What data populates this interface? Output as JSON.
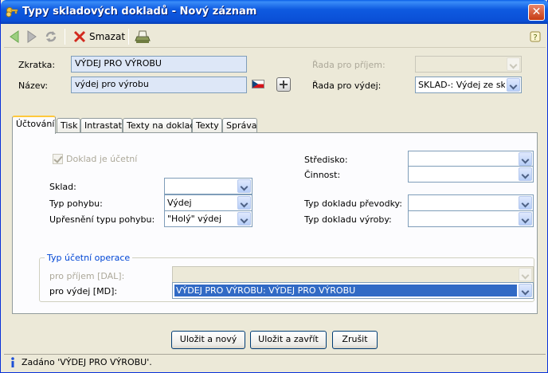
{
  "window": {
    "title": "Typy skladových dokladů - Nový záznam",
    "close_label": "✕"
  },
  "toolbar": {
    "delete_label": "Smazat"
  },
  "header": {
    "code_label": "Zkratka:",
    "code_value": "VÝDEJ PRO VÝROBU",
    "name_label": "Název:",
    "name_value": "výdej pro výrobu",
    "series_in_label": "Řada pro příjem:",
    "series_in_value": "",
    "series_out_label": "Řada pro výdej:",
    "series_out_value": "SKLAD-: Výdej ze sk..."
  },
  "tabs": [
    {
      "label": "Účtování"
    },
    {
      "label": "Tisk"
    },
    {
      "label": "Intrastat"
    },
    {
      "label": "Texty na doklad"
    },
    {
      "label": "Texty"
    },
    {
      "label": "Správa"
    }
  ],
  "accounting": {
    "is_accounting_label": "Doklad je účetní",
    "warehouse_label": "Sklad:",
    "warehouse_value": "",
    "movement_type_label": "Typ pohybu:",
    "movement_type_value": "Výdej",
    "movement_detail_label": "Upřesnění typu pohybu:",
    "movement_detail_value": "\"Holý\" výdej",
    "center_label": "Středisko:",
    "center_value": "",
    "activity_label": "Činnost:",
    "activity_value": "",
    "transfer_doc_label": "Typ dokladu převodky:",
    "transfer_doc_value": "",
    "production_doc_label": "Typ dokladu výroby:",
    "production_doc_value": "",
    "operation_group_label": "Typ účetní operace",
    "op_in_label": "pro příjem [DAL]:",
    "op_in_value": "",
    "op_out_label": "pro výdej [MD]:",
    "op_out_value": "VÝDEJ PRO VÝROBU: VÝDEJ PRO VÝROBU"
  },
  "buttons": {
    "save_new": "Uložit a nový",
    "save_close": "Uložit a zavřít",
    "cancel": "Zrušit"
  },
  "status": {
    "message": "Zadáno 'VÝDEJ PRO VÝROBU'."
  },
  "colors": {
    "title_bar": "#0a4fd6",
    "selection": "#316ac5",
    "tab_accent": "#ffc83c",
    "group_title": "#0046d5"
  }
}
